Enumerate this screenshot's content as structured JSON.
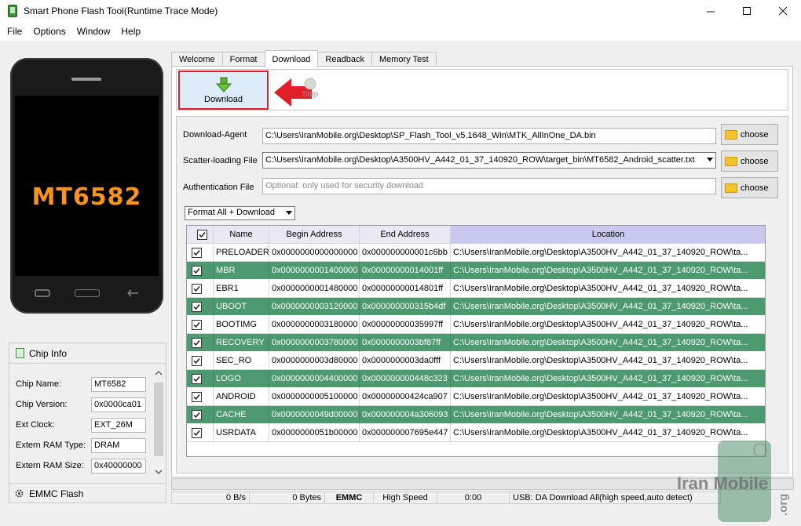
{
  "window": {
    "title": "Smart Phone Flash Tool(Runtime Trace Mode)"
  },
  "menu": [
    "File",
    "Options",
    "Window",
    "Help"
  ],
  "phone": {
    "chip": "MT6582"
  },
  "chip_info": {
    "header": "Chip Info",
    "rows": [
      {
        "label": "Chip Name:",
        "value": "MT6582"
      },
      {
        "label": "Chip Version:",
        "value": "0x0000ca01"
      },
      {
        "label": "Ext Clock:",
        "value": "EXT_26M"
      },
      {
        "label": "Extern RAM Type:",
        "value": "DRAM"
      },
      {
        "label": "Extern RAM Size:",
        "value": "0x40000000"
      }
    ],
    "emmc_flash": "EMMC Flash"
  },
  "tabs": [
    "Welcome",
    "Format",
    "Download",
    "Readback",
    "Memory Test"
  ],
  "active_tab": "Download",
  "toolbar": {
    "download_label": "Download",
    "stop_label": "Stop"
  },
  "form": {
    "download_agent_label": "Download-Agent",
    "download_agent_value": "C:\\Users\\IranMobile.org\\Desktop\\SP_Flash_Tool_v5.1648_Win\\MTK_AllInOne_DA.bin",
    "scatter_label": "Scatter-loading File",
    "scatter_value": "C:\\Users\\IranMobile.org\\Desktop\\A3500HV_A442_01_37_140920_ROW\\target_bin\\MT6582_Android_scatter.txt",
    "auth_label": "Authentication File",
    "auth_placeholder": "Optional: only used for security download",
    "choose_label": "choose",
    "mode": "Format All + Download"
  },
  "table": {
    "headers": [
      "Name",
      "Begin Address",
      "End Address",
      "Location"
    ],
    "rows": [
      {
        "name": "PRELOADER",
        "begin": "0x0000000000000000",
        "end": "0x000000000001c6bb",
        "location": "C:\\Users\\IranMobile.org\\Desktop\\A3500HV_A442_01_37_140920_ROW\\ta...",
        "highlight": false
      },
      {
        "name": "MBR",
        "begin": "0x0000000001400000",
        "end": "0x00000000014001ff",
        "location": "C:\\Users\\IranMobile.org\\Desktop\\A3500HV_A442_01_37_140920_ROW\\ta...",
        "highlight": true
      },
      {
        "name": "EBR1",
        "begin": "0x0000000001480000",
        "end": "0x00000000014801ff",
        "location": "C:\\Users\\IranMobile.org\\Desktop\\A3500HV_A442_01_37_140920_ROW\\ta...",
        "highlight": false
      },
      {
        "name": "UBOOT",
        "begin": "0x0000000003120000",
        "end": "0x000000000315b4df",
        "location": "C:\\Users\\IranMobile.org\\Desktop\\A3500HV_A442_01_37_140920_ROW\\ta...",
        "highlight": true
      },
      {
        "name": "BOOTIMG",
        "begin": "0x0000000003180000",
        "end": "0x00000000035997ff",
        "location": "C:\\Users\\IranMobile.org\\Desktop\\A3500HV_A442_01_37_140920_ROW\\ta...",
        "highlight": false
      },
      {
        "name": "RECOVERY",
        "begin": "0x0000000003780000",
        "end": "0x0000000003bf87ff",
        "location": "C:\\Users\\IranMobile.org\\Desktop\\A3500HV_A442_01_37_140920_ROW\\ta...",
        "highlight": true
      },
      {
        "name": "SEC_RO",
        "begin": "0x0000000003d80000",
        "end": "0x0000000003da0fff",
        "location": "C:\\Users\\IranMobile.org\\Desktop\\A3500HV_A442_01_37_140920_ROW\\ta...",
        "highlight": false
      },
      {
        "name": "LOGO",
        "begin": "0x0000000004400000",
        "end": "0x000000000448c323",
        "location": "C:\\Users\\IranMobile.org\\Desktop\\A3500HV_A442_01_37_140920_ROW\\ta...",
        "highlight": true
      },
      {
        "name": "ANDROID",
        "begin": "0x0000000005100000",
        "end": "0x00000000424ca907",
        "location": "C:\\Users\\IranMobile.org\\Desktop\\A3500HV_A442_01_37_140920_ROW\\ta...",
        "highlight": false
      },
      {
        "name": "CACHE",
        "begin": "0x0000000049d00000",
        "end": "0x000000004a306093",
        "location": "C:\\Users\\IranMobile.org\\Desktop\\A3500HV_A442_01_37_140920_ROW\\ta...",
        "highlight": true
      },
      {
        "name": "USRDATA",
        "begin": "0x0000000051b00000",
        "end": "0x000000007695e447",
        "location": "C:\\Users\\IranMobile.org\\Desktop\\A3500HV_A442_01_37_140920_ROW\\ta...",
        "highlight": false
      }
    ]
  },
  "status": {
    "speed": "0 B/s",
    "bytes": "0 Bytes",
    "storage": "EMMC",
    "mode": "High Speed",
    "time": "0:00",
    "usb": "USB: DA Download All(high speed,auto detect)"
  },
  "watermark": {
    "text": "Iran Mobile",
    "suffix": ".org"
  },
  "colors": {
    "highlight_row": "#4d9a70",
    "download_button_bg": "#dcecf8",
    "callout_red": "#e01f26",
    "chip_orange": "#f7941d"
  },
  "icons": {
    "app": "phone-app-icon",
    "download": "green-down-arrow-icon",
    "stop": "stop-icon",
    "choose": "folder-icon",
    "chip_info": "chip-info-icon",
    "emmc": "gear-icon"
  }
}
